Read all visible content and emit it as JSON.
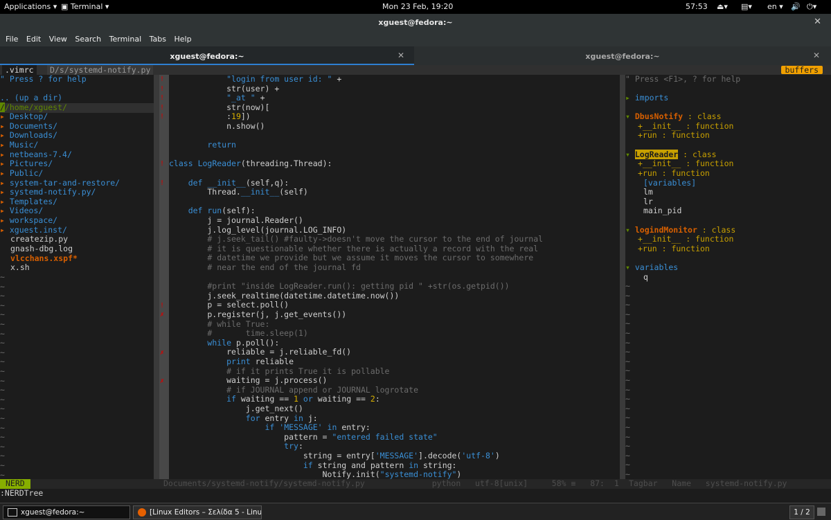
{
  "topbar": {
    "applications": "Applications",
    "terminal": "Terminal",
    "datetime": "Mon 23 Feb, 19:20",
    "battery": "57:53",
    "lang": "en"
  },
  "window": {
    "title": "xguest@fedora:~"
  },
  "menu": [
    "File",
    "Edit",
    "View",
    "Search",
    "Terminal",
    "Tabs",
    "Help"
  ],
  "tabs": [
    {
      "label": "xguest@fedora:~"
    },
    {
      "label": "xguest@fedora:~"
    }
  ],
  "vim": {
    "tabline": {
      "tab1": ".vimrc",
      "tab2": "D/s/systemd-notify.py",
      "buffers": "buffers"
    },
    "nerdtree": {
      "help": "\" Press ? for help",
      "updir": ".. (up a dir)",
      "root": "/home/xguest/",
      "dirs": [
        "Desktop/",
        "Documents/",
        "Downloads/",
        "Music/",
        "netbeans-7.4/",
        "Pictures/",
        "Public/",
        "system-tar-and-restore/",
        "systemd-notify.py/",
        "Templates/",
        "Videos/",
        "workspace/",
        "xguest.inst/"
      ],
      "files": [
        "createzip.py",
        "gnash-dbg.log",
        "vlcchans.xspf*",
        "x.sh"
      ],
      "status": "NERD",
      "cmdline": ":NERDTree"
    },
    "code": [
      "            \"login from user id: \" +",
      "            str(user) +",
      "            \"_at \" +",
      "            str(now)[",
      "            :19])",
      "            n.show()",
      "",
      "        return",
      "",
      "class LogReader(threading.Thread):",
      "",
      "    def __init__(self,q):",
      "        Thread.__init__(self)",
      "",
      "    def run(self):",
      "        j = journal.Reader()",
      "        j.log_level(journal.LOG_INFO)",
      "        # j.seek_tail() #faulty->doesn't move the cursor to the end of journal",
      "        # it is questionable whether there is actually a record with the real",
      "        # datetime we provide but we assume it moves the cursor to somewhere",
      "        # near the end of the journal fd",
      "",
      "        #print \"inside LogReader.run(): getting pid \" +str(os.getpid())",
      "        j.seek_realtime(datetime.datetime.now())",
      "        p = select.poll()",
      "        p.register(j, j.get_events())",
      "        # while True:",
      "        #       time.sleep(1)",
      "        while p.poll():",
      "            reliable = j.reliable_fd()",
      "            print reliable",
      "            # if it prints True it is pollable",
      "            waiting = j.process()",
      "            # if JOURNAL append or JOURNAL logrotate",
      "            if waiting == 1 or waiting == 2:",
      "                j.get_next()",
      "                for entry in j:",
      "                    if 'MESSAGE' in entry:",
      "                        pattern = \"entered failed state\"",
      "                        try:",
      "                            string = entry['MESSAGE'].decode('utf-8')",
      "                            if string and pattern in string:",
      "                                Notify.init(\"systemd-notify\")"
    ],
    "status_main": "Documents/systemd-notify/systemd-notify.py              python   utf-8[unix]     58% ≡   87:  1",
    "tagbar": {
      "help": "\" Press <F1>, ? for help",
      "imports": "imports",
      "classes": [
        {
          "name": "DbusNotify",
          "kind": "class",
          "members": [
            "+__init__ : function",
            "+run : function"
          ]
        },
        {
          "name": "LogReader",
          "kind": "class",
          "members": [
            "+__init__ : function",
            "+run : function"
          ],
          "vars": [
            "[variables]",
            "lm",
            "lr",
            "main_pid"
          ]
        },
        {
          "name": "logindMonitor",
          "kind": "class",
          "members": [
            "+__init__ : function",
            "+run : function"
          ]
        }
      ],
      "variables": "variables",
      "var_q": "q",
      "status": "Tagbar   Name   systemd-notify.py"
    }
  },
  "taskbar": {
    "task1": "xguest@fedora:~",
    "task2": "[Linux Editors – Σελίδα 5 - Linux...",
    "workspace": "1 / 2"
  }
}
